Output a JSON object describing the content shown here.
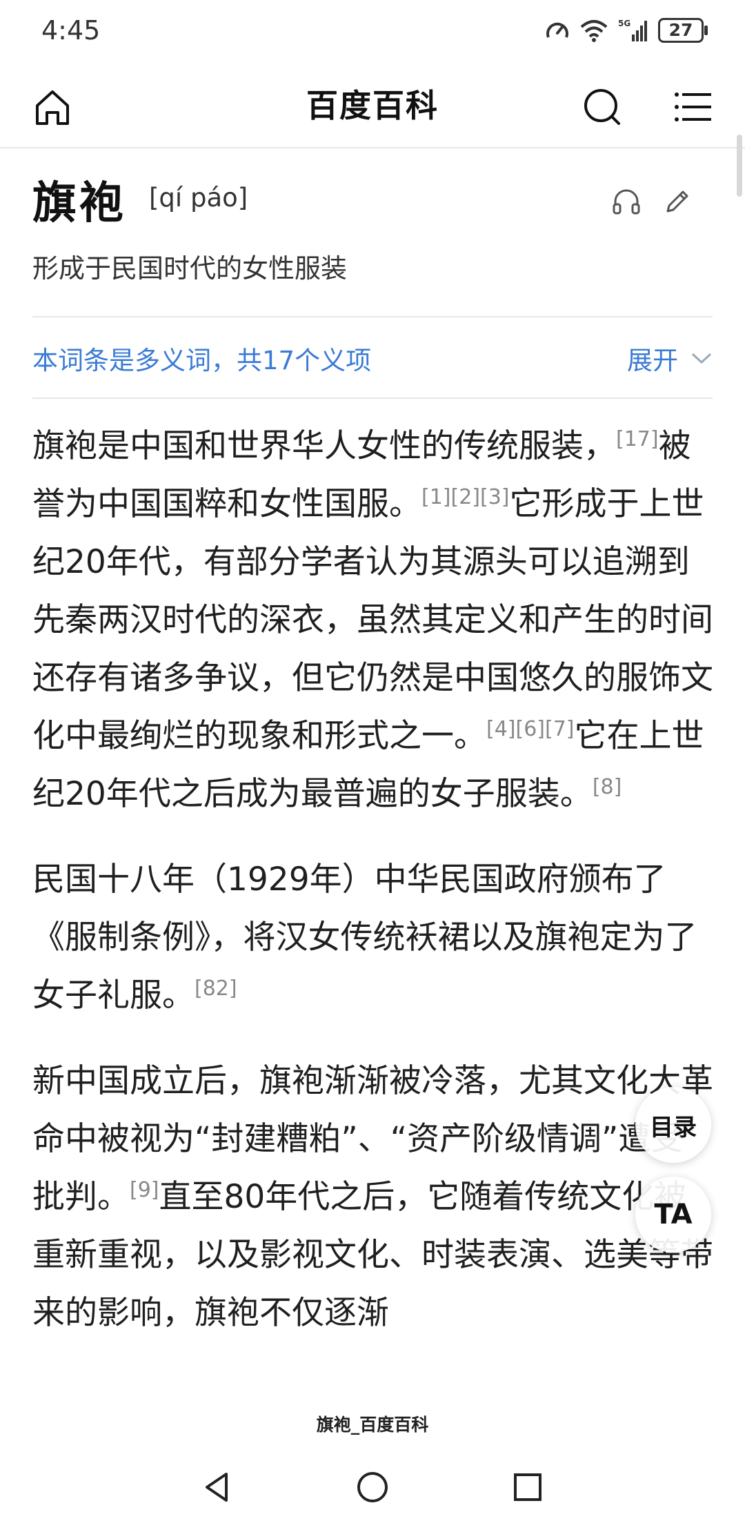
{
  "status_bar": {
    "time": "4:45",
    "battery": "27"
  },
  "header": {
    "title": "百度百科"
  },
  "entry": {
    "term": "旗袍",
    "pinyin": "[qí páo]",
    "subtitle": "形成于民国时代的女性服装",
    "polysemy_text": "本词条是多义词，共17个义项",
    "expand_label": "展开"
  },
  "paragraphs": [
    [
      {
        "t": "旗袍是中国和世界华人女性的传统服装，"
      },
      {
        "r": "[17]"
      },
      {
        "t": "被誉为中国国粹和女性国服。"
      },
      {
        "r": "[1][2][3]"
      },
      {
        "t": "它形成于上世纪20年代，有部分学者认为其源头可以追溯到先秦两汉时代的深衣，虽然其定义和产生的时间还存有诸多争议，但它仍然是中国悠久的服饰文化中最绚烂的现象和形式之一。"
      },
      {
        "r": "[4][6][7]"
      },
      {
        "t": "它在上世纪20年代之后成为最普遍的女子服装。"
      },
      {
        "r": "[8]"
      }
    ],
    [
      {
        "t": "民国十八年（1929年）中华民国政府颁布了《服制条例》，将汉女传统袄裙以及旗袍定为了女子礼服。"
      },
      {
        "r": "[82]"
      }
    ],
    [
      {
        "t": "新中国成立后，旗袍渐渐被冷落，尤其文化大革命中被视为“封建糟粕”、“资产阶级情调”遭受批判。"
      },
      {
        "r": "[9]"
      },
      {
        "t": "直至80年代之后，它随着传统文化被重新重视，以及影视文化、时装表演、选美等带来的影响，旗袍不仅逐渐"
      }
    ]
  ],
  "floating": {
    "toc_label": "目录",
    "font_label": "TA"
  },
  "footer": {
    "page_title": "旗袍_百度百科"
  },
  "colors": {
    "link": "#3a7bd5",
    "text": "#1f1f1f",
    "ref": "#888888"
  },
  "icons": [
    "home-icon",
    "search-icon",
    "menu-icon",
    "headphones-icon",
    "edit-icon",
    "chevron-down-icon",
    "back-icon",
    "home-nav-icon",
    "recents-icon"
  ]
}
